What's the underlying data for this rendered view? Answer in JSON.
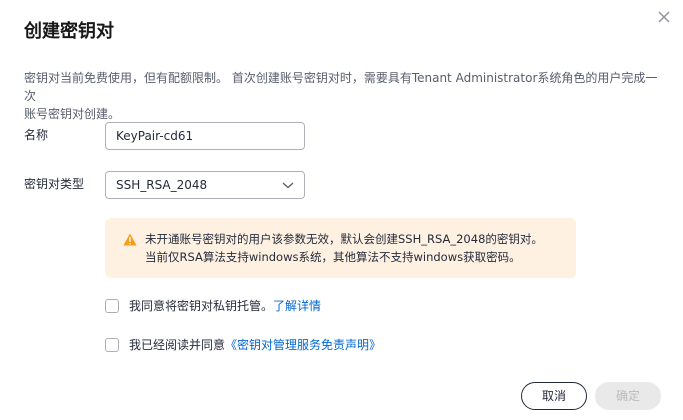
{
  "dialog": {
    "title": "创建密钥对",
    "description_line1": "密钥对当前免费使用，但有配额限制。 首次创建账号密钥对时，需要具有Tenant Administrator系统角色的用户完成一次",
    "description_line2": "账号密钥对创建。"
  },
  "form": {
    "name_label": "名称",
    "name_value": "KeyPair-cd61",
    "type_label": "密钥对类型",
    "type_value": "SSH_RSA_2048"
  },
  "alert": {
    "line1": "未开通账号密钥对的用户该参数无效，默认会创建SSH_RSA_2048的密钥对。",
    "line2": "当前仅RSA算法支持windows系统，其他算法不支持windows获取密码。"
  },
  "agreements": {
    "escrow_text": "我同意将密钥对私钥托管。",
    "escrow_link": "了解详情",
    "disclaimer_text": "我已经阅读并同意",
    "disclaimer_link": "《密钥对管理服务免责声明》"
  },
  "footer": {
    "cancel_label": "取消",
    "confirm_label": "确定"
  },
  "colors": {
    "link": "#0067d1",
    "warning": "#f69d1c",
    "alert_bg": "#fef1e2"
  },
  "icons": {
    "close": "close-icon",
    "dropdown": "chevron-down-icon",
    "warning": "warning-icon"
  }
}
